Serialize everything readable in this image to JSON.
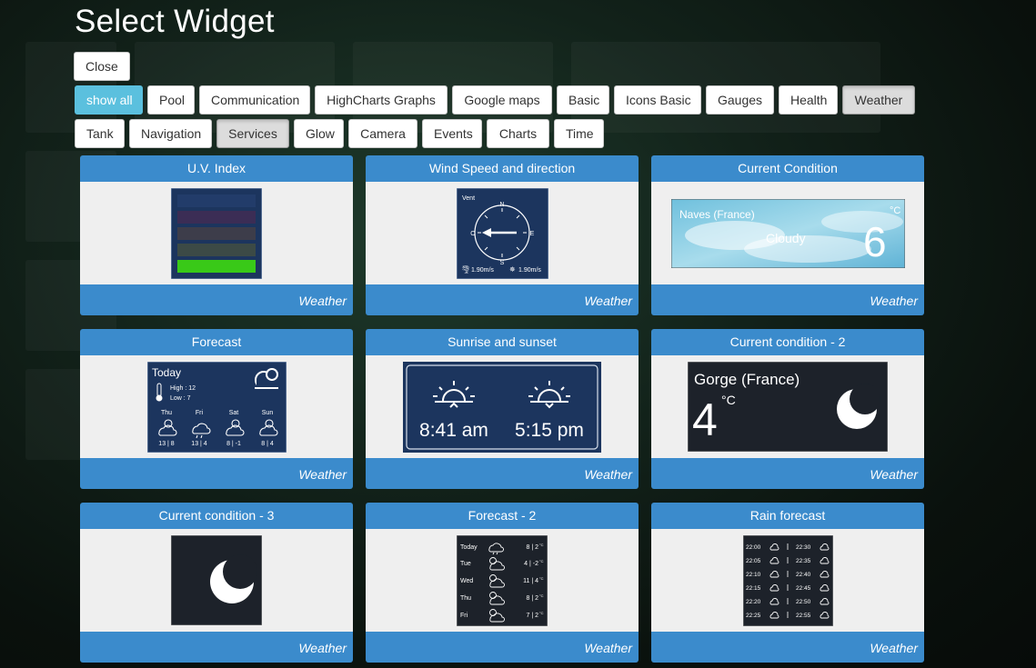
{
  "dialog": {
    "title": "Select Widget",
    "close_label": "Close"
  },
  "filters": {
    "row1": [
      "show all",
      "Pool",
      "Communication",
      "HighCharts Graphs",
      "Google maps",
      "Basic",
      "Icons Basic",
      "Gauges",
      "Health",
      "Weather"
    ],
    "row2": [
      "Tank",
      "Navigation",
      "Services",
      "Glow",
      "Camera",
      "Events",
      "Charts",
      "Time"
    ],
    "active": "show all",
    "pressed": [
      "Weather",
      "Services"
    ]
  },
  "widgets": [
    {
      "title": "U.V. Index",
      "category": "Weather"
    },
    {
      "title": "Wind Speed and direction",
      "category": "Weather",
      "preview": {
        "label": "Vent",
        "n": "N",
        "s": "S",
        "e": "E",
        "o": "O",
        "speed1": "1.90m/s",
        "speed2": "1.90m/s"
      }
    },
    {
      "title": "Current Condition",
      "category": "Weather",
      "preview": {
        "location": "Naves (France)",
        "condition": "Cloudy",
        "temp": "6",
        "unit": "°C"
      }
    },
    {
      "title": "Forecast",
      "category": "Weather",
      "preview": {
        "day": "Today",
        "high": "High : 12",
        "low": "Low : 7",
        "days": [
          {
            "d": "Thu",
            "v": "13 | 8"
          },
          {
            "d": "Fri",
            "v": "13 | 4"
          },
          {
            "d": "Sat",
            "v": "8 | -1"
          },
          {
            "d": "Sun",
            "v": "8 | 4"
          }
        ]
      }
    },
    {
      "title": "Sunrise and sunset",
      "category": "Weather",
      "preview": {
        "sunrise": "8:41 am",
        "sunset": "5:15 pm"
      }
    },
    {
      "title": "Current condition - 2",
      "category": "Weather",
      "preview": {
        "location": "Gorge (France)",
        "temp": "4",
        "unit": "°C"
      }
    },
    {
      "title": "Current condition - 3",
      "category": "Weather"
    },
    {
      "title": "Forecast - 2",
      "category": "Weather",
      "preview": {
        "rows": [
          {
            "d": "Today",
            "v": "8 | 2",
            "u": "°C"
          },
          {
            "d": "Tue",
            "v": "4 | -2",
            "u": "°C"
          },
          {
            "d": "Wed",
            "v": "11 | 4",
            "u": "°C"
          },
          {
            "d": "Thu",
            "v": "8 | 2",
            "u": "°C"
          },
          {
            "d": "Fri",
            "v": "7 | 2",
            "u": "°C"
          }
        ]
      }
    },
    {
      "title": "Rain forecast",
      "category": "Weather",
      "preview": {
        "rows": [
          [
            "22:00",
            "22:30"
          ],
          [
            "22:05",
            "22:35"
          ],
          [
            "22:10",
            "22:40"
          ],
          [
            "22:15",
            "22:45"
          ],
          [
            "22:20",
            "22:50"
          ],
          [
            "22:25",
            "22:55"
          ]
        ]
      }
    }
  ],
  "colors": {
    "accent": "#3b8bcc",
    "active_button": "#5bc0de",
    "preview_dark": "#1d222a",
    "preview_navy": "#1c355e"
  }
}
